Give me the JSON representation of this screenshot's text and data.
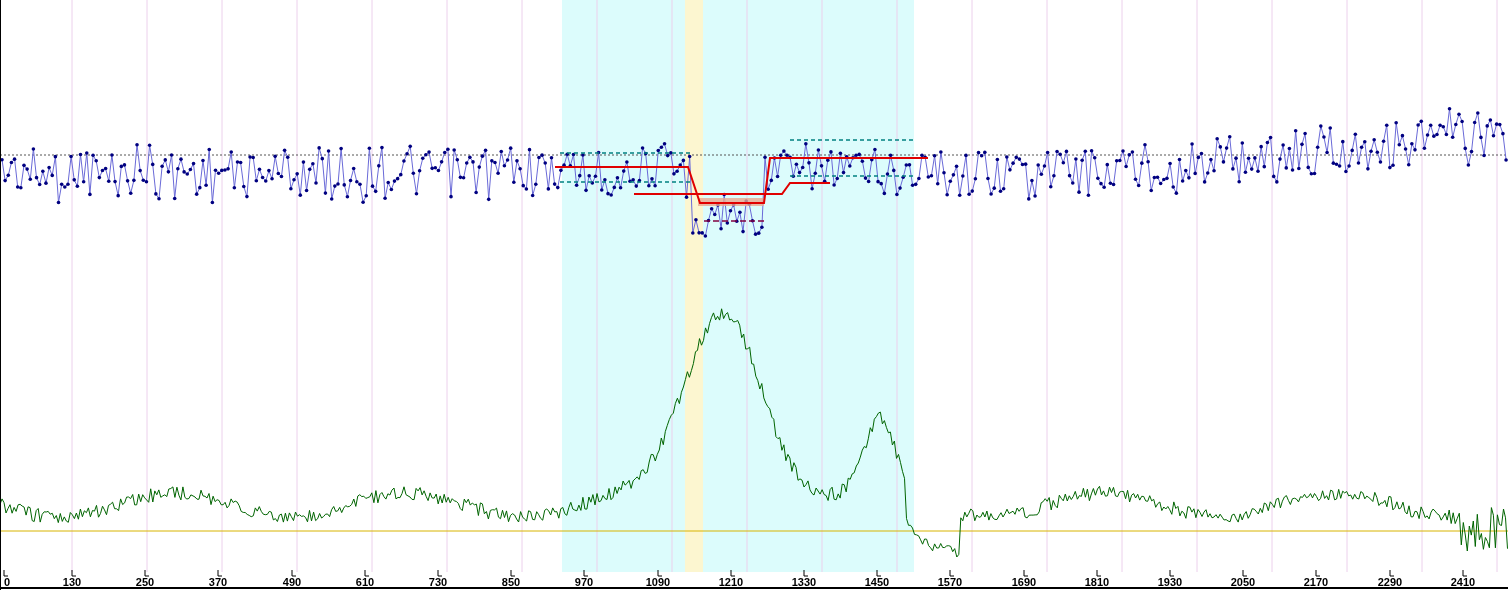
{
  "chart": {
    "x_tick_labels": [
      "0",
      "130",
      "250",
      "370",
      "490",
      "610",
      "730",
      "850",
      "970",
      "1090",
      "1210",
      "1330",
      "1450",
      "1570",
      "1690",
      "1810",
      "1930",
      "2050",
      "2170",
      "2290",
      "2410"
    ]
  }
}
